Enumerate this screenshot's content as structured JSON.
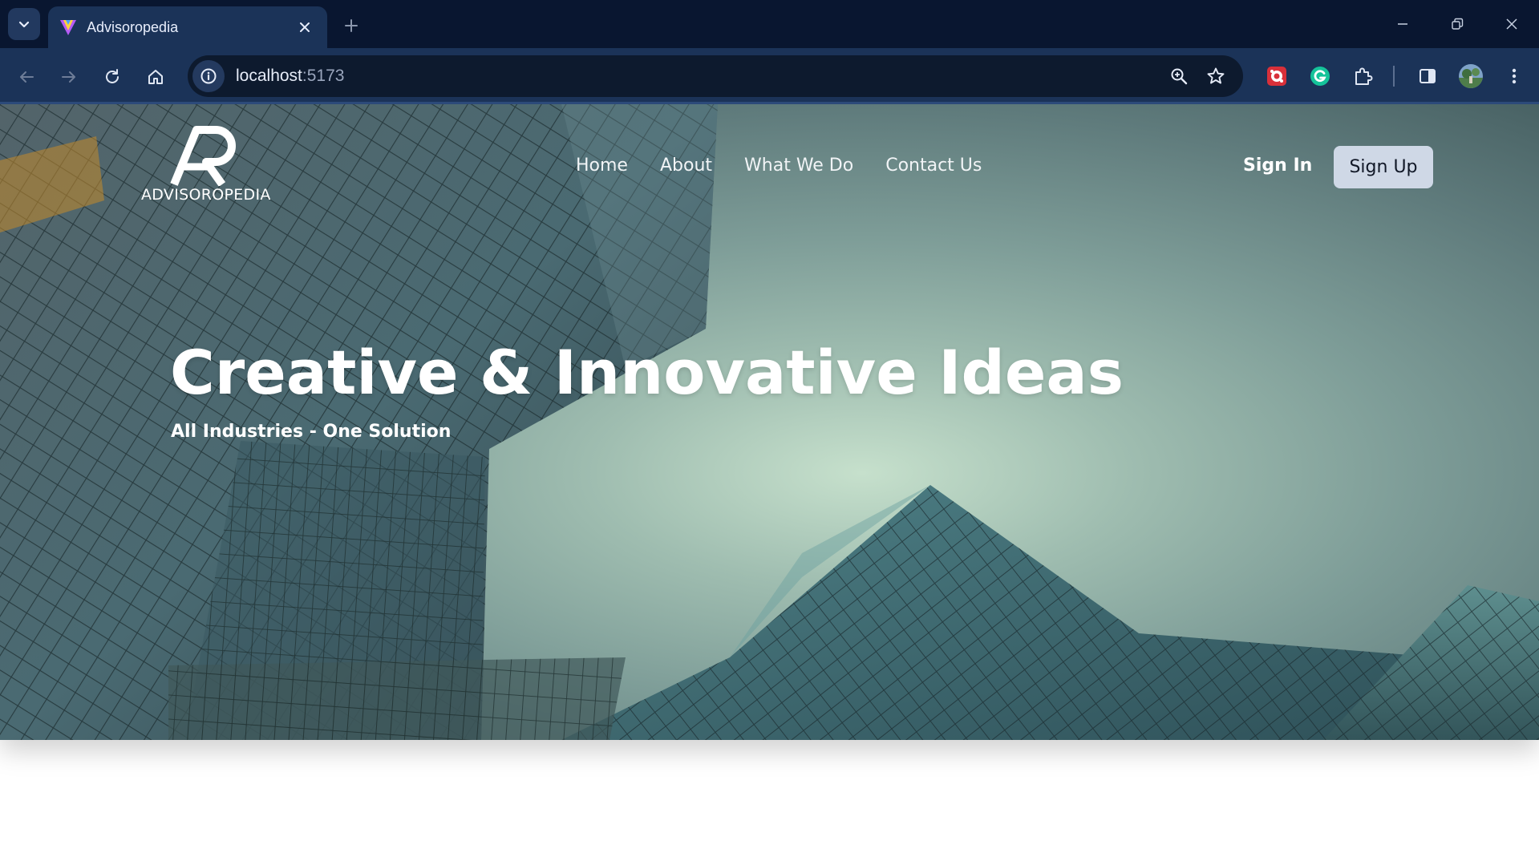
{
  "browser": {
    "tab_title": "Advisoropedia",
    "url_host": "localhost",
    "url_port": ":5173",
    "icons": [
      "tab-search-icon",
      "favicon-icon",
      "close-icon",
      "plus-icon",
      "minimize-icon",
      "restore-icon",
      "close-window-icon",
      "back-icon",
      "forward-icon",
      "reload-icon",
      "home-icon",
      "site-info-icon",
      "zoom-icon",
      "bookmark-star-icon",
      "extension-red-icon",
      "grammarly-icon",
      "extensions-puzzle-icon",
      "side-panel-icon",
      "profile-avatar-icon",
      "menu-kebab-icon"
    ]
  },
  "site": {
    "logo_text": "ADVISOROPEDIA",
    "nav": [
      "Home",
      "About",
      "What We Do",
      "Contact Us"
    ],
    "sign_in": "Sign In",
    "sign_up": "Sign Up",
    "hero_title": "Creative & Innovative Ideas",
    "hero_subtitle": "All Industries - One Solution"
  },
  "colors": {
    "chrome_bg": "#091630",
    "toolbar_bg": "#1b3358",
    "signup_bg": "#cfd8e6"
  }
}
